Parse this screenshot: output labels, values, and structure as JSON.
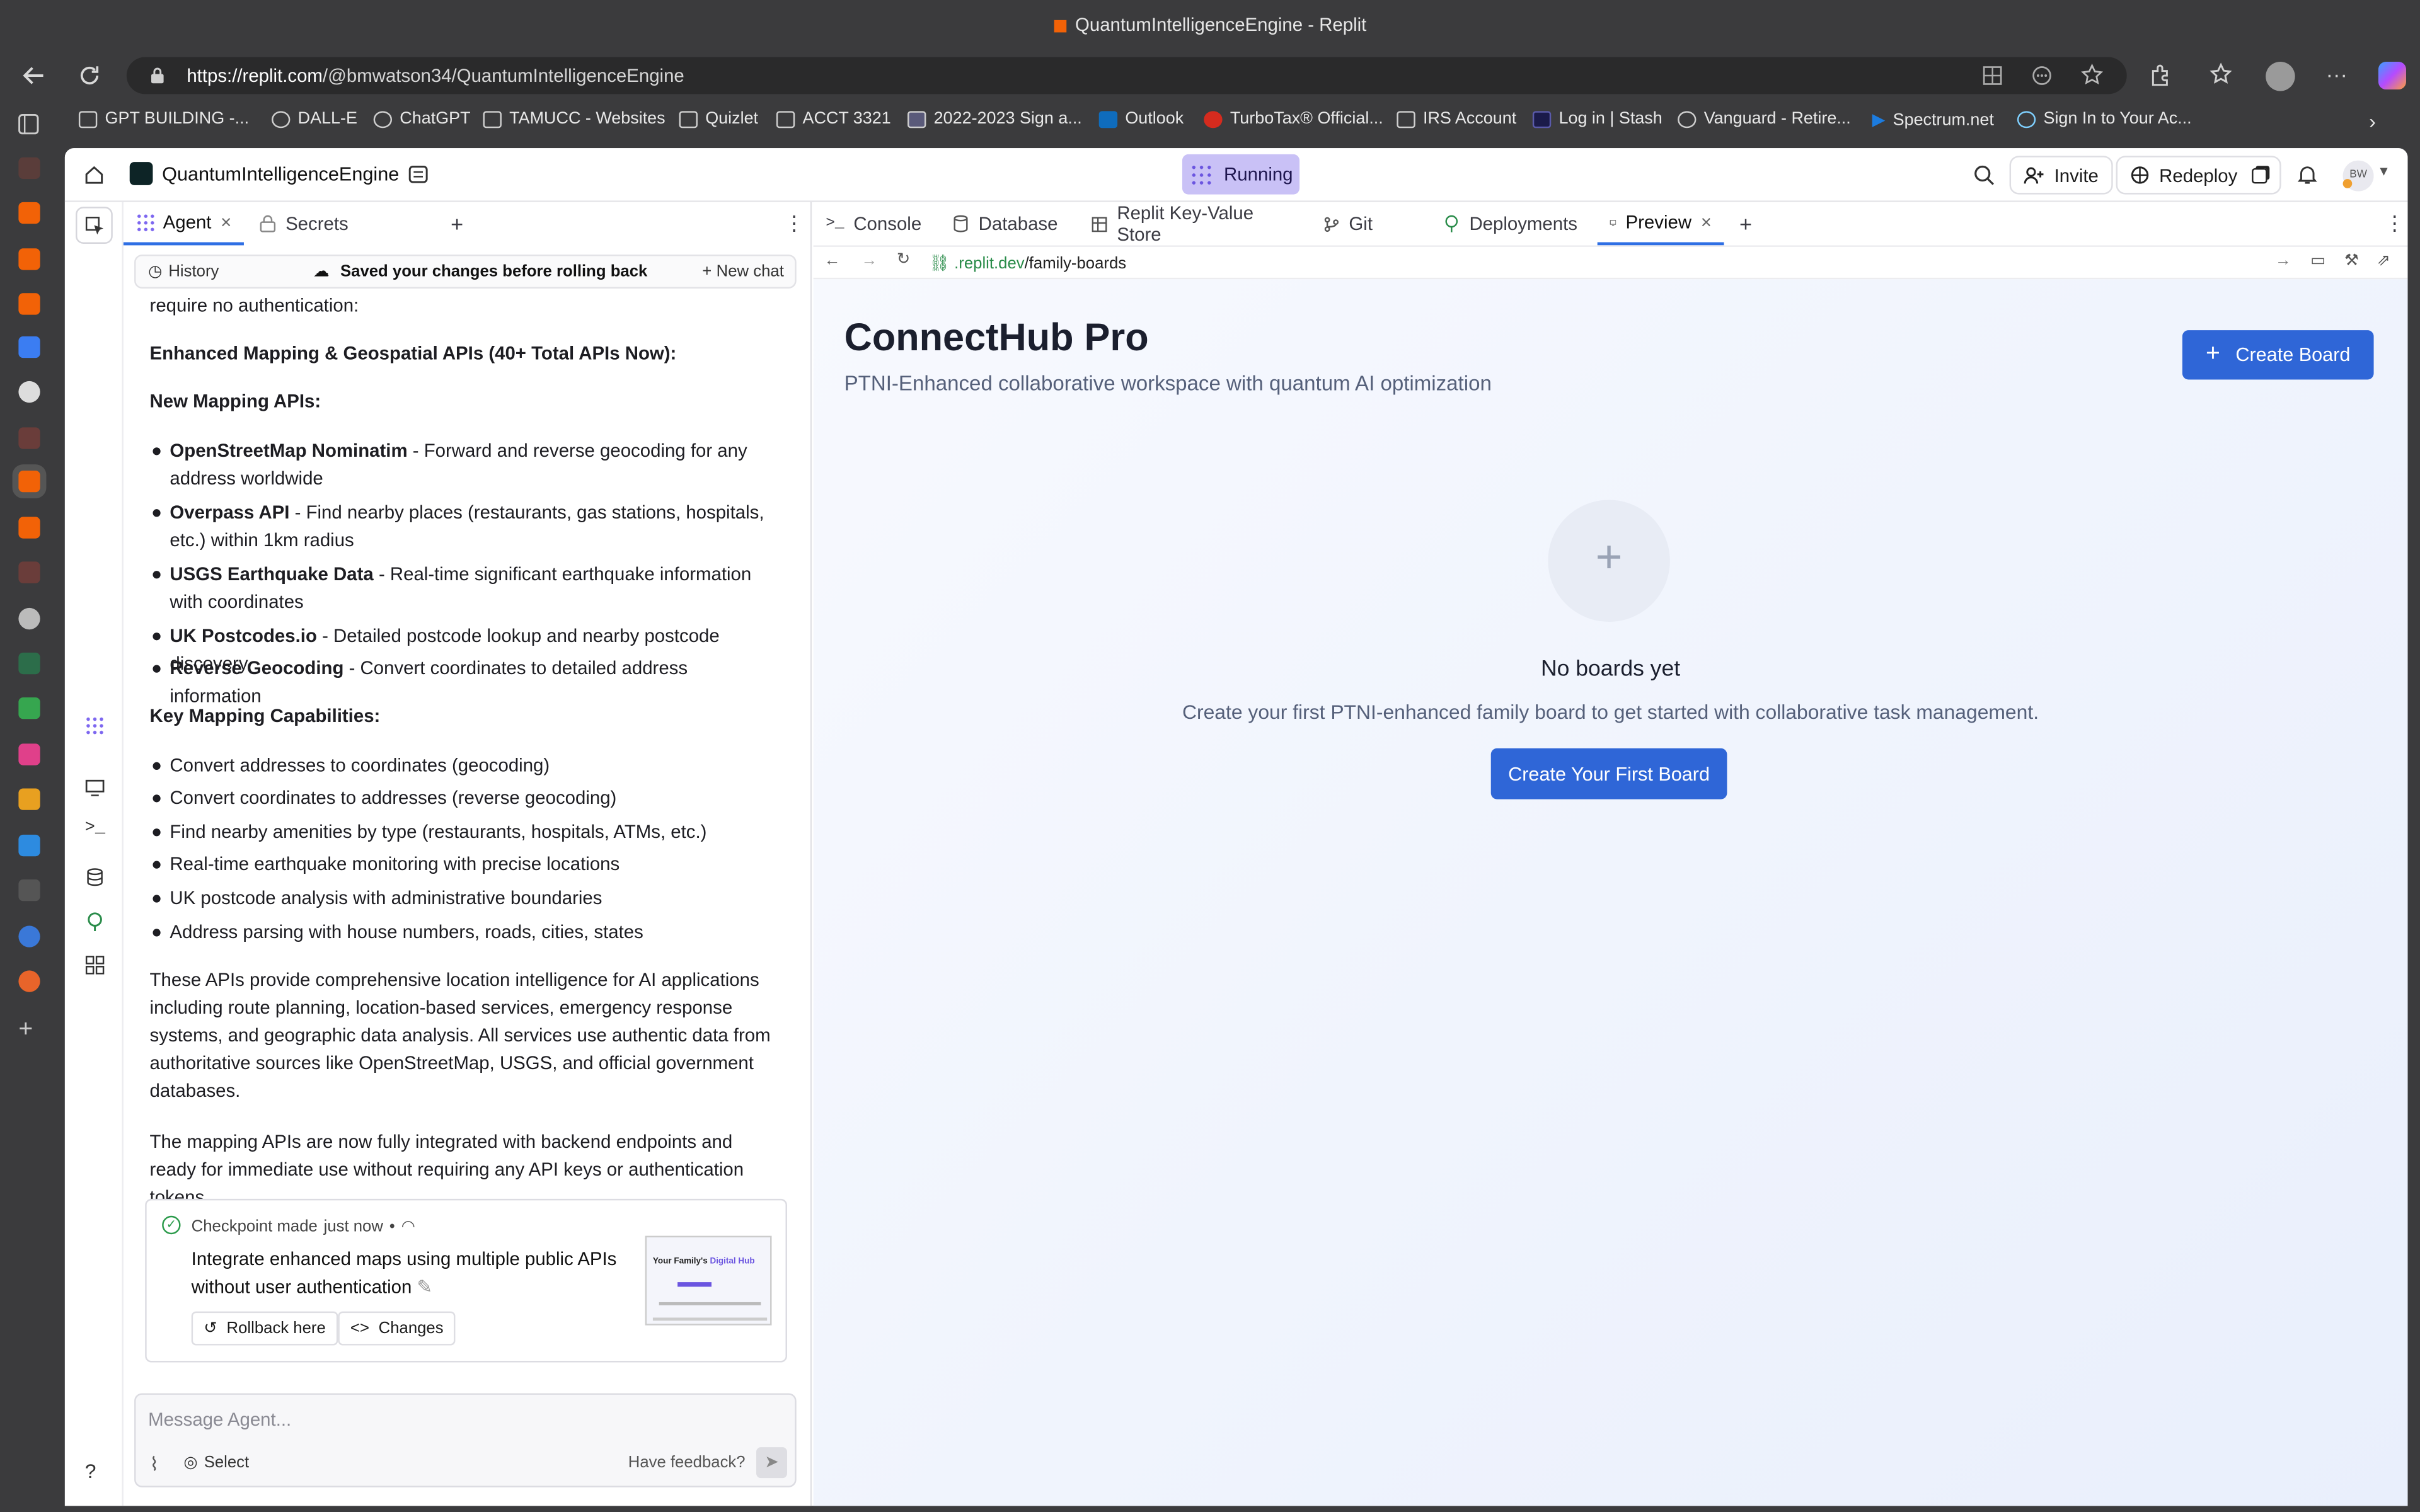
{
  "browser": {
    "window_title": "QuantumIntelligenceEngine - Replit",
    "url_host": "https://replit.com",
    "url_path": "/@bmwatson34/QuantumIntelligenceEngine",
    "bookmarks": [
      "GPT BUILDING -...",
      "DALL-E",
      "ChatGPT",
      "TAMUCC - Websites",
      "Quizlet",
      "ACCT 3321",
      "2022-2023 Sign a...",
      "Outlook",
      "TurboTax® Official...",
      "IRS Account",
      "Log in | Stash",
      "Vanguard - Retire...",
      "Spectrum.net",
      "Sign In to Your Ac..."
    ]
  },
  "header": {
    "project_name": "QuantumIntelligenceEngine",
    "status": "Running",
    "invite": "Invite",
    "redeploy": "Redeploy",
    "avatar_initials": "BW"
  },
  "left_tabs": {
    "agent": "Agent",
    "secrets": "Secrets"
  },
  "agent_bar": {
    "history": "History",
    "saved": "Saved your changes before rolling back",
    "new_chat": "New chat"
  },
  "chat": {
    "intro_tail": "require no authentication:",
    "heading1": "Enhanced Mapping & Geospatial APIs (40+ Total APIs Now):",
    "heading2": "New Mapping APIs:",
    "apis": [
      {
        "name": "OpenStreetMap Nominatim",
        "desc": " - Forward and reverse geocoding for any address worldwide"
      },
      {
        "name": "Overpass API",
        "desc": " - Find nearby places (restaurants, gas stations, hospitals, etc.) within 1km radius"
      },
      {
        "name": "USGS Earthquake Data",
        "desc": " - Real-time significant earthquake information with coordinates"
      },
      {
        "name": "UK Postcodes.io",
        "desc": " - Detailed postcode lookup and nearby postcode discovery"
      },
      {
        "name": "Reverse Geocoding",
        "desc": " - Convert coordinates to detailed address information"
      }
    ],
    "heading3": "Key Mapping Capabilities:",
    "capabilities": [
      "Convert addresses to coordinates (geocoding)",
      "Convert coordinates to addresses (reverse geocoding)",
      "Find nearby amenities by type (restaurants, hospitals, ATMs, etc.)",
      "Real-time earthquake monitoring with precise locations",
      "UK postcode analysis with administrative boundaries",
      "Address parsing with house numbers, roads, cities, states"
    ],
    "para1": "These APIs provide comprehensive location intelligence for AI applications including route planning, location-based services, emergency response systems, and geographic data analysis. All services use authentic data from authoritative sources like OpenStreetMap, USGS, and official government databases.",
    "para2": "The mapping APIs are now fully integrated with backend endpoints and ready for immediate use without requiring any API keys or authentication tokens."
  },
  "checkpoint": {
    "label": "Checkpoint made",
    "time": "just now",
    "separator": "•",
    "title": "Integrate enhanced maps using multiple public APIs without user authentication",
    "rollback": "Rollback here",
    "changes": "Changes",
    "thumb_title_a": "Your Family's ",
    "thumb_title_b": "Digital Hub"
  },
  "composer": {
    "placeholder": "Message Agent...",
    "select": "Select",
    "feedback": "Have feedback?"
  },
  "right_tabs": [
    "Console",
    "Database",
    "Replit Key-Value Store",
    "Git",
    "Deployments",
    "Preview"
  ],
  "preview_bar": {
    "url_prefix": ".replit.dev",
    "url_path": "/family-boards"
  },
  "app_page": {
    "title": "ConnectHub Pro",
    "subtitle": "PTNI-Enhanced collaborative workspace with quantum AI optimization",
    "create_board": "Create Board",
    "empty_title": "No boards yet",
    "empty_desc": "Create your first PTNI-enhanced family board to get started with collaborative task management.",
    "create_first": "Create Your First Board"
  },
  "colors": {
    "accent": "#2f66d7",
    "running": "#c9c1f6",
    "chrome": "#3b3b3d"
  }
}
